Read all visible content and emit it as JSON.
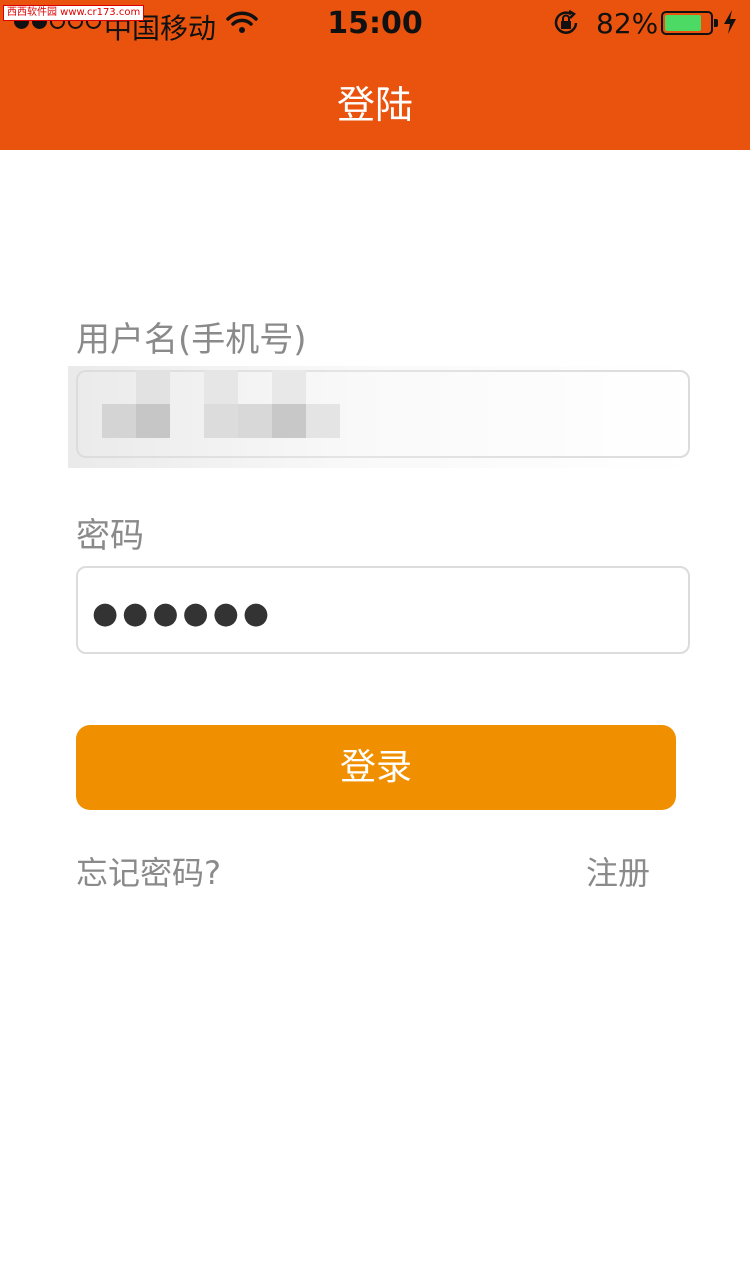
{
  "status_bar": {
    "carrier": "中国移动",
    "time": "15:00",
    "battery_percent": "82%",
    "battery_level": 0.82,
    "signal_bars_filled": 2,
    "signal_bars_total": 5,
    "watermark": "西西软件园 www.cr173.com"
  },
  "nav": {
    "title": "登陆",
    "background": "#e9530e"
  },
  "form": {
    "username_label": "用户名(手机号)",
    "password_label": "密码",
    "password_value": "●●●●●●"
  },
  "actions": {
    "login_label": "登录",
    "login_color": "#f09000",
    "forgot_label": "忘记密码?",
    "register_label": "注册"
  }
}
